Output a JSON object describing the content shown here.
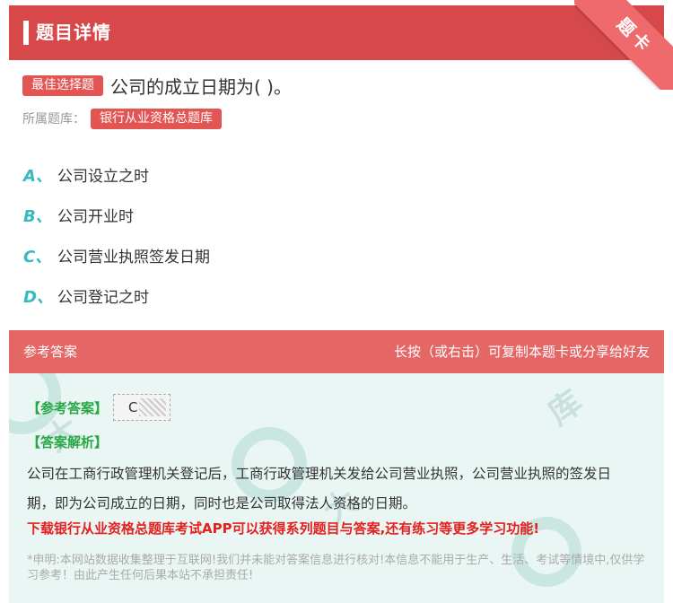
{
  "header": {
    "title": "题目详情",
    "ribbon": "题卡"
  },
  "question": {
    "type_badge": "最佳选择题",
    "text": "公司的成立日期为( )。",
    "bank_label": "所属题库：",
    "bank_name": "银行从业资格总题库"
  },
  "options": [
    {
      "letter": "A、",
      "text": "公司设立之时"
    },
    {
      "letter": "B、",
      "text": "公司开业时"
    },
    {
      "letter": "C、",
      "text": "公司营业执照签发日期"
    },
    {
      "letter": "D、",
      "text": "公司登记之时"
    }
  ],
  "answer": {
    "section_title": "参考答案",
    "hint": "长按（或右击）可复制本题卡或分享给好友",
    "ref_label": "【参考答案】",
    "ref_value": "C",
    "analysis_label": "【答案解析】",
    "analysis_text": "公司在工商行政管理机关登记后，工商行政管理机关发给公司营业执照，公司营业执照的签发日期，即为公司成立的日期，同时也是公司取得法人资格的日期。",
    "promo": "下载银行从业资格总题库考试APP可以获得系列题目与答案,还有练习等更多学习功能!",
    "disclaimer": "*申明:本网站数据收集整理于互联网!我们并未能对答案信息进行核对!本信息不能用于生产、生活、考试等情境中,仅供学习参考！由此产生任何后果本站不承担责任!"
  },
  "colors": {
    "header_bg": "#d7484a",
    "badge_bg": "#e25553",
    "option_letter": "#36b9c0",
    "answer_head_bg": "#e46665",
    "answer_body_bg": "#eaf6f3",
    "green_label": "#28a745",
    "promo_red": "#e4201e"
  }
}
